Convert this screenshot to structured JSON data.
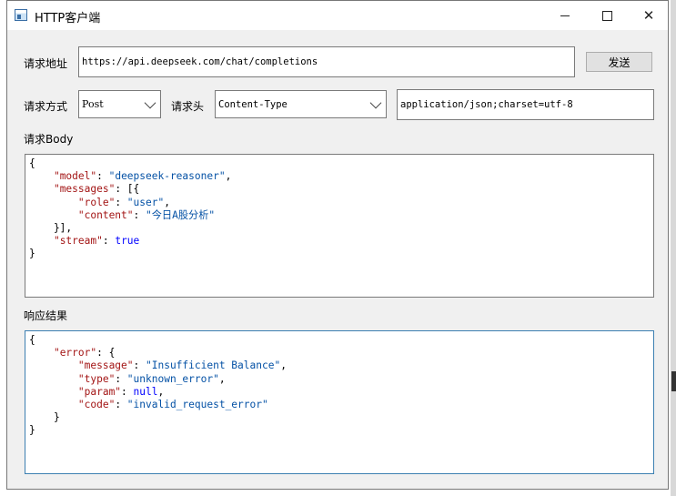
{
  "window": {
    "title": "HTTP客户端",
    "controls": {
      "minimize": "—",
      "maximize": "☐",
      "close": "✕"
    }
  },
  "request": {
    "url_label": "请求地址",
    "url_value": "https://api.deepseek.com/chat/completions",
    "send_label": "发送",
    "method_label": "请求方式",
    "method_value": "Post",
    "header_label": "请求头",
    "header_key": "Content-Type",
    "header_value": "application/json;charset=utf-8",
    "body_label": "请求Body",
    "body_lines": [
      [
        {
          "t": "p",
          "v": "{"
        }
      ],
      [
        {
          "t": "p",
          "v": "    "
        },
        {
          "t": "k",
          "v": "\"model\""
        },
        {
          "t": "p",
          "v": ": "
        },
        {
          "t": "s",
          "v": "\"deepseek-reasoner\""
        },
        {
          "t": "p",
          "v": ","
        }
      ],
      [
        {
          "t": "p",
          "v": "    "
        },
        {
          "t": "k",
          "v": "\"messages\""
        },
        {
          "t": "p",
          "v": ": [{"
        }
      ],
      [
        {
          "t": "p",
          "v": "        "
        },
        {
          "t": "k",
          "v": "\"role\""
        },
        {
          "t": "p",
          "v": ": "
        },
        {
          "t": "s",
          "v": "\"user\""
        },
        {
          "t": "p",
          "v": ","
        }
      ],
      [
        {
          "t": "p",
          "v": "        "
        },
        {
          "t": "k",
          "v": "\"content\""
        },
        {
          "t": "p",
          "v": ": "
        },
        {
          "t": "s",
          "v": "\"今日A股分析\""
        }
      ],
      [
        {
          "t": "p",
          "v": "    }],"
        }
      ],
      [
        {
          "t": "p",
          "v": "    "
        },
        {
          "t": "k",
          "v": "\"stream\""
        },
        {
          "t": "p",
          "v": ": "
        },
        {
          "t": "v",
          "v": "true"
        }
      ],
      [
        {
          "t": "p",
          "v": "}"
        }
      ]
    ]
  },
  "response": {
    "label": "响应结果",
    "lines": [
      [
        {
          "t": "p",
          "v": "{"
        }
      ],
      [
        {
          "t": "p",
          "v": "    "
        },
        {
          "t": "k",
          "v": "\"error\""
        },
        {
          "t": "p",
          "v": ": {"
        }
      ],
      [
        {
          "t": "p",
          "v": "        "
        },
        {
          "t": "k",
          "v": "\"message\""
        },
        {
          "t": "p",
          "v": ": "
        },
        {
          "t": "s",
          "v": "\"Insufficient Balance\""
        },
        {
          "t": "p",
          "v": ","
        }
      ],
      [
        {
          "t": "p",
          "v": "        "
        },
        {
          "t": "k",
          "v": "\"type\""
        },
        {
          "t": "p",
          "v": ": "
        },
        {
          "t": "s",
          "v": "\"unknown_error\""
        },
        {
          "t": "p",
          "v": ","
        }
      ],
      [
        {
          "t": "p",
          "v": "        "
        },
        {
          "t": "k",
          "v": "\"param\""
        },
        {
          "t": "p",
          "v": ": "
        },
        {
          "t": "v",
          "v": "null"
        },
        {
          "t": "p",
          "v": ","
        }
      ],
      [
        {
          "t": "p",
          "v": "        "
        },
        {
          "t": "k",
          "v": "\"code\""
        },
        {
          "t": "p",
          "v": ": "
        },
        {
          "t": "s",
          "v": "\"invalid_request_error\""
        }
      ],
      [
        {
          "t": "p",
          "v": "    }"
        }
      ],
      [
        {
          "t": "p",
          "v": "}"
        }
      ]
    ]
  },
  "colors": {
    "json_key": "#a31515",
    "json_string": "#0451a5",
    "json_literal": "#0000ff",
    "focus_border": "#3c7fb1"
  }
}
